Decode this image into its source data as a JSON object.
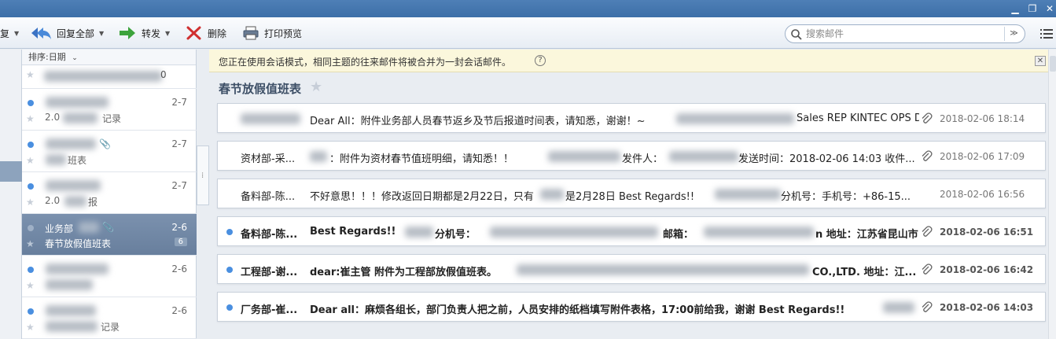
{
  "toolbar": {
    "reply_partial": "复",
    "reply_all": "回复全部",
    "forward": "转发",
    "delete": "删除",
    "print_preview": "打印预览"
  },
  "search": {
    "placeholder": "搜索邮件"
  },
  "sort": {
    "label": "排序:日期"
  },
  "message_list": [
    {
      "sender": "",
      "subject": "",
      "date": "",
      "unread": false,
      "partial_text": "0"
    },
    {
      "sender": "",
      "subject": "2.0",
      "date": "2-7",
      "unread": true,
      "subject_tail": "记录"
    },
    {
      "sender": "",
      "subject": "",
      "date": "2-7",
      "unread": true,
      "subject_tail": "班表"
    },
    {
      "sender": "",
      "subject": "2.0",
      "date": "2-7",
      "unread": true,
      "subject_tail": "报"
    },
    {
      "sender": "业务部",
      "subject": "春节放假值班表",
      "date": "2-6",
      "unread": false,
      "count": "6"
    },
    {
      "sender": "",
      "subject": "",
      "date": "2-6",
      "unread": true
    },
    {
      "sender": "",
      "subject": "",
      "date": "2-6",
      "unread": true,
      "subject_tail": "记录"
    }
  ],
  "notice": {
    "text": "您正在使用会话模式，相同主题的往来邮件将被合并为一封会话邮件。",
    "help": "?"
  },
  "conversation": {
    "title": "春节放假值班表",
    "messages": [
      {
        "sender": "",
        "preview": "Dear All：附件业务部人员春节返乡及节后报道时间表，请知悉，谢谢！~",
        "preview_tail": "Sales REP KINTEC OPS Dept...",
        "date": "2018-02-06 18:14",
        "unread": false
      },
      {
        "sender": "资材部-采...",
        "preview": "：附件为资材春节值班明细，请知悉！！",
        "preview_mid": "发件人：",
        "preview_tail": "发送时间：2018-02-06 14:03 收件...",
        "date": "2018-02-06 17:09",
        "unread": false
      },
      {
        "sender": "备料部-陈...",
        "preview": "不好意思！！！修改返回日期都是2月22日，只有",
        "preview_mid": "是2月28日 Best Regards!!",
        "preview_tail": "分机号：手机号：+86-15...",
        "date": "2018-02-06 16:56",
        "unread": false
      },
      {
        "sender": "备料部-陈...",
        "preview": "Best Regards!!",
        "preview_mid": "分机号：",
        "preview_tail": "邮箱：",
        "preview_end": "n 地址：江苏省昆山市...",
        "date": "2018-02-06 16:51",
        "unread": true
      },
      {
        "sender": "工程部-谢...",
        "preview": "dear:崔主管 附件为工程部放假值班表。",
        "preview_tail": "CO.,LTD. 地址：江...",
        "date": "2018-02-06 16:42",
        "unread": true
      },
      {
        "sender": "厂务部-崔...",
        "preview": "Dear all：麻烦各组长，部门负责人把之前，人员安排的纸档填写附件表格，17:00前给我，谢谢 Best Regards!!",
        "date": "2018-02-06 14:03",
        "unread": true
      }
    ]
  }
}
